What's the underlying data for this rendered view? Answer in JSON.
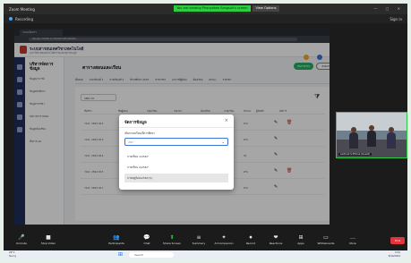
{
  "zoom": {
    "window_title": "Zoom Meeting",
    "viewing_banner": "You are viewing Phonpakee Sangsuk's screen",
    "view_options": "View Options",
    "recording_label": "Recording",
    "signin": "Sign in",
    "toolbar": [
      {
        "icon": "🎤",
        "label": "Unmute"
      },
      {
        "icon": "■",
        "label": "Stop Video"
      },
      {
        "icon": "👥",
        "label": "Participants"
      },
      {
        "icon": "💬",
        "label": "Chat"
      },
      {
        "icon": "⬆",
        "label": "Share Screen"
      },
      {
        "icon": "≡",
        "label": "Summary"
      },
      {
        "icon": "✦",
        "label": "AI Companion"
      },
      {
        "icon": "⏺",
        "label": "Record"
      },
      {
        "icon": "❤",
        "label": "Reactions"
      },
      {
        "icon": "⊞",
        "label": "Apps"
      },
      {
        "icon": "▭",
        "label": "Whiteboards"
      },
      {
        "icon": "…",
        "label": "More"
      }
    ],
    "end_label": "End",
    "participants_count": "8"
  },
  "browser": {
    "tab_label": "ระบบจัดการ",
    "url": "dip.erp.rmutsb.ac.th/admin/timetable"
  },
  "app": {
    "title": "ระบบสารสนเทศวิชาเทคโนโลยี",
    "subtitle": "มหาวิทยาลัยเทคโนโลยีราชมงคลสุวรรณภูมิ",
    "sidebar_title": "บริหารจัดการ ข้อมูล",
    "sidebar_items": [
      "ข้อมูลอาจารย์",
      "ข้อมูลนักศึกษา",
      "ข้อมูลรายวิชา",
      "จัดการตารางสอน",
      "ข้อมูลห้องเรียน",
      "ตั้งค่าระบบ"
    ],
    "main_title": "ตารางสอนและเรียน",
    "add_button": "เพิ่มรายวิชา",
    "export_button": "ส่งออกข้อมูล",
    "filters": [
      "ทั้งหมด",
      "ภาคเรียนที่ 1",
      "ภาคเรียนที่ 2",
      "ปีการศึกษา 2567",
      "สาขาวิชา",
      "อาจารย์ผู้สอน",
      "ห้องเรียน",
      "สถานะ",
      "รายวิชา"
    ],
    "page_size": "แสดง 10",
    "table_headers": [
      "ชื่อวิชา",
      "ชื่อผู้สอน",
      "กลุ่มเรียน",
      "วันเวลา",
      "ห้องเรียน",
      "ภาคเรียน",
      "สถานะ",
      "ผู้บันทึก",
      "จัดการ"
    ],
    "rows": [
      {
        "code": "วท.ค. 2564 R12",
        "name": "รายวิชา 1",
        "time": "08:00-11:00",
        "status": "ผ่าน"
      },
      {
        "code": "วท.ค. 2564 R13",
        "name": "รายวิชา 2",
        "time": "13:00-16:00",
        "status": "ผ่าน"
      },
      {
        "code": "วท.ค. 2564 R14",
        "name": "รายวิชา 3",
        "time": "09:00-12:00",
        "status": "รอ"
      },
      {
        "code": "วท.ค. 2564 R15",
        "name": "รายวิชา 4",
        "time": "13:00-16:00",
        "status": "ผ่าน"
      },
      {
        "code": "วท.ค. 2564 R17",
        "name": "รายวิชา 5",
        "time": "08:00-11:00",
        "status": "ผ่าน"
      }
    ]
  },
  "modal": {
    "title": "จัดการข้อมูล",
    "field_label": "เลือกภาคเรียน/ปีการศึกษา",
    "placeholder": "เลือก",
    "options": [
      "ภาคเรียน 1/2567",
      "ภาคเรียน 2/2567",
      "ภาคฤดูร้อน/2567(3)"
    ],
    "selected_index": 2
  },
  "video": {
    "name_tag": "Lecturer's iPhone (Guest)"
  },
  "taskbar": {
    "weather_temp": "29°C",
    "weather_desc": "Sunny",
    "search_placeholder": "Search",
    "time": "9:51",
    "date": "8/14/2024"
  },
  "colors": {
    "banner_green": "#2ecc40",
    "end_red": "#e5333d",
    "app_navy": "#1f2d5a",
    "primary_green": "#27ae60"
  }
}
